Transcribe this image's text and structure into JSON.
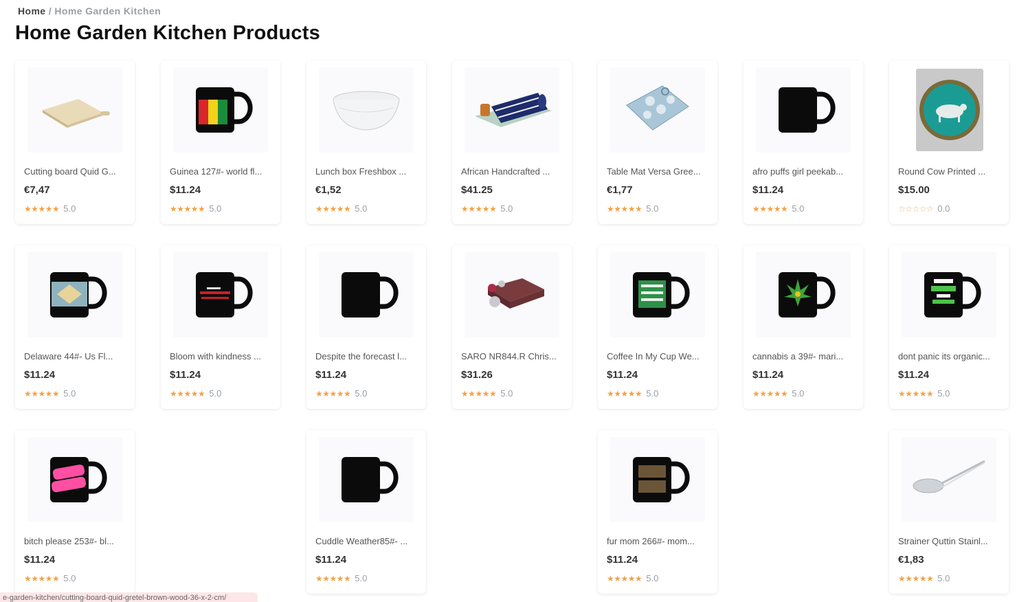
{
  "breadcrumb": {
    "home": "Home",
    "separator": "/",
    "current": "Home Garden Kitchen"
  },
  "page_title": "Home Garden Kitchen Products",
  "status_url": "e-garden-kitchen/cutting-board-quid-gretel-brown-wood-36-x-2-cm/",
  "colors": {
    "star": "#f0a348",
    "mug": "#0b0b0b"
  },
  "products": [
    {
      "name": "Cutting board Quid G...",
      "price": "€7,47",
      "rating": "5.0",
      "stars": "★★★★★",
      "icon": "cutting-board-icon"
    },
    {
      "name": "Guinea 127#- world fl...",
      "price": "$11.24",
      "rating": "5.0",
      "stars": "★★★★★",
      "icon": "mug-icon"
    },
    {
      "name": "Lunch box Freshbox ...",
      "price": "€1,52",
      "rating": "5.0",
      "stars": "★★★★★",
      "icon": "lunch-box-icon"
    },
    {
      "name": "African Handcrafted ...",
      "price": "$41.25",
      "rating": "5.0",
      "stars": "★★★★★",
      "icon": "table-runner-icon"
    },
    {
      "name": "Table Mat Versa Gree...",
      "price": "€1,77",
      "rating": "5.0",
      "stars": "★★★★★",
      "icon": "table-mat-icon"
    },
    {
      "name": "afro puffs girl peekab...",
      "price": "$11.24",
      "rating": "5.0",
      "stars": "★★★★★",
      "icon": "mug-icon"
    },
    {
      "name": "Round Cow Printed ...",
      "price": "$15.00",
      "rating": "0.0",
      "stars": "☆☆☆☆☆",
      "icon": "round-tray-icon"
    },
    {
      "name": "Delaware 44#- Us Fl...",
      "price": "$11.24",
      "rating": "5.0",
      "stars": "★★★★★",
      "icon": "mug-icon"
    },
    {
      "name": "Bloom with kindness ...",
      "price": "$11.24",
      "rating": "5.0",
      "stars": "★★★★★",
      "icon": "mug-icon"
    },
    {
      "name": "Despite the forecast l...",
      "price": "$11.24",
      "rating": "5.0",
      "stars": "★★★★★",
      "icon": "mug-icon"
    },
    {
      "name": "SARO NR844.R Chris...",
      "price": "$31.26",
      "rating": "5.0",
      "stars": "★★★★★",
      "icon": "napkin-ring-icon"
    },
    {
      "name": "Coffee In My Cup We...",
      "price": "$11.24",
      "rating": "5.0",
      "stars": "★★★★★",
      "icon": "mug-icon"
    },
    {
      "name": "cannabis a 39#- mari...",
      "price": "$11.24",
      "rating": "5.0",
      "stars": "★★★★★",
      "icon": "mug-icon"
    },
    {
      "name": "dont panic its organic...",
      "price": "$11.24",
      "rating": "5.0",
      "stars": "★★★★★",
      "icon": "mug-icon"
    },
    {
      "name": "bitch please 253#- bl...",
      "price": "$11.24",
      "rating": "5.0",
      "stars": "★★★★★",
      "icon": "mug-icon"
    },
    {
      "name": "Cuddle Weather85#- ...",
      "price": "$11.24",
      "rating": "5.0",
      "stars": "★★★★★",
      "icon": "mug-icon"
    },
    {
      "name": "fur mom 266#- mom...",
      "price": "$11.24",
      "rating": "5.0",
      "stars": "★★★★★",
      "icon": "mug-icon"
    },
    {
      "name": "Strainer Quttin Stainl...",
      "price": "€1,83",
      "rating": "5.0",
      "stars": "★★★★★",
      "icon": "strainer-icon"
    }
  ]
}
